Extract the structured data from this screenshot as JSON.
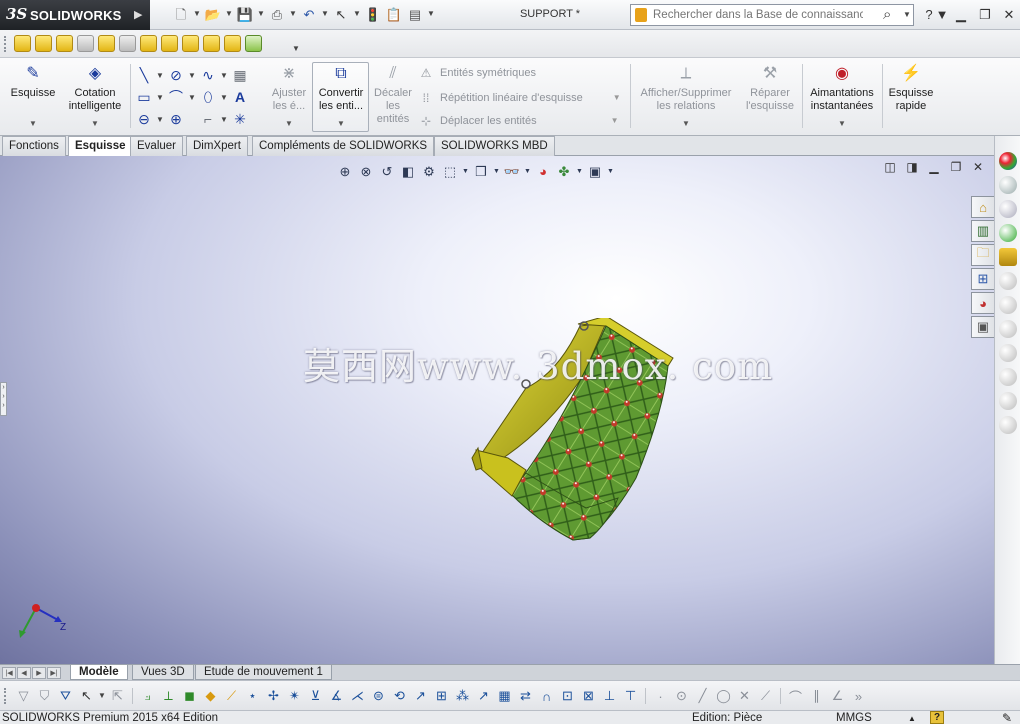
{
  "app": {
    "logo_prefix": "3S",
    "logo_name": "SOLIDWORKS",
    "document_title": "SUPPORT *"
  },
  "search": {
    "placeholder": "Rechercher dans la Base de connaissances"
  },
  "ribbon": {
    "esquisse": "Esquisse",
    "cotation": "Cotation intelligente",
    "ajuster": "Ajuster les é...",
    "convertir": "Convertir les enti...",
    "decaler": "Décaler les entités",
    "entites_symetriques": "Entités symétriques",
    "repetition": "Répétition linéaire d'esquisse",
    "deplacer": "Déplacer les entités",
    "afficher_relations": "Afficher/Supprimer les relations",
    "reparer": "Réparer l'esquisse",
    "aimantations": "Aimantations instantanées",
    "esquisse_rapide": "Esquisse rapide"
  },
  "tabs": [
    {
      "label": "Fonctions"
    },
    {
      "label": "Esquisse"
    },
    {
      "label": "Evaluer"
    },
    {
      "label": "DimXpert"
    },
    {
      "label": "Compléments de SOLIDWORKS"
    },
    {
      "label": "SOLIDWORKS MBD"
    }
  ],
  "watermark": "莫西网www. 3dmox. com",
  "model_tabs": [
    {
      "label": "Modèle"
    },
    {
      "label": "Vues 3D"
    },
    {
      "label": "Etude de mouvement 1"
    }
  ],
  "triad": {
    "z_label": "Z"
  },
  "status": {
    "product": "SOLIDWORKS Premium 2015 x64 Edition",
    "mode": "Edition: Pièce",
    "units": "MMGS",
    "help": "?"
  },
  "colors": {
    "accent": "#1b3b9c",
    "model_yellow": "#c8c21c",
    "model_green": "#4f8a2a",
    "ribbon_bg": "#eef0f3"
  }
}
